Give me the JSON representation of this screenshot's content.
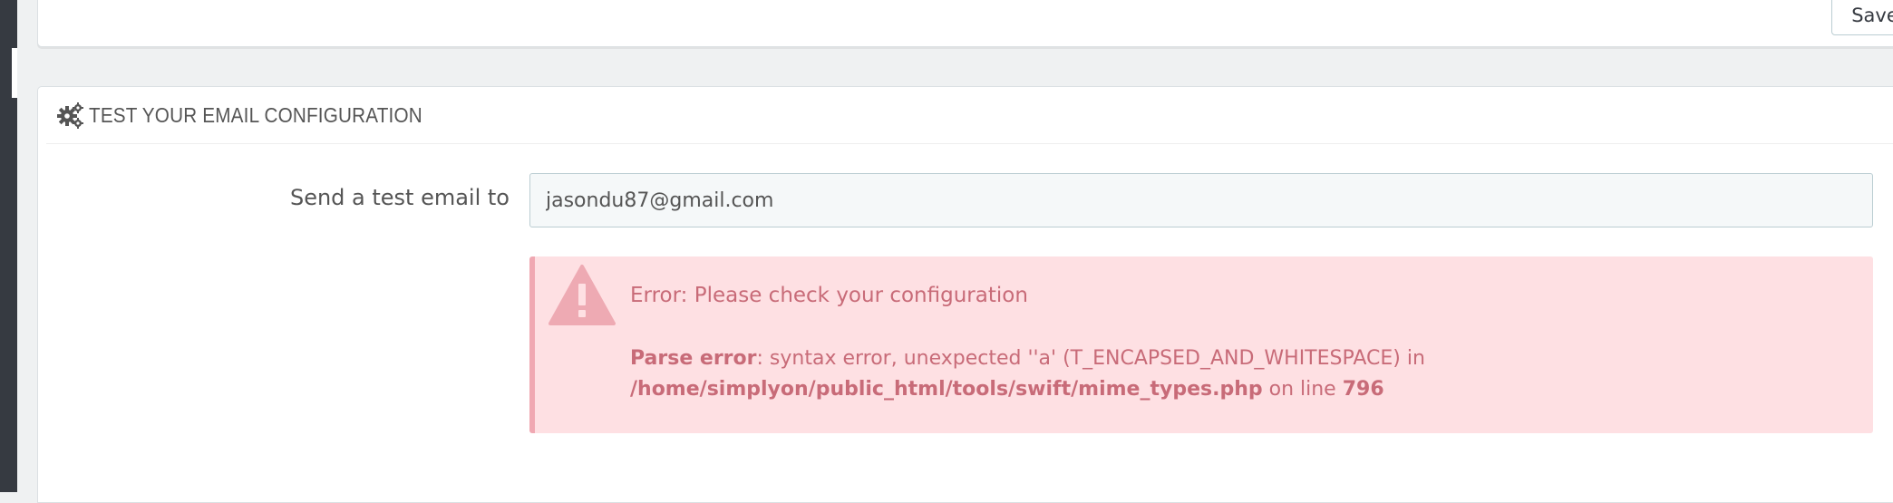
{
  "toolbar": {
    "save_label": "Save"
  },
  "panel": {
    "icon": "cogs-icon",
    "title": "TEST YOUR EMAIL CONFIGURATION"
  },
  "form": {
    "label": "Send a test email to",
    "email_value": "jasondu87@gmail.com"
  },
  "alert": {
    "icon": "warning-icon",
    "title": "Error: Please check your configuration",
    "parse_label": "Parse error",
    "message": ": syntax error, unexpected ''a' (T_ENCAPSED_AND_WHITESPACE) in",
    "path": "/home/simplyon/public_html/tools/swift/mime_types.php",
    "line_prefix": " on line ",
    "line_number": "796"
  },
  "colors": {
    "sidebar": "#363a41",
    "alert_bg": "#fee0e3",
    "alert_text": "#c86b78",
    "alert_border": "#f0a8b2"
  }
}
